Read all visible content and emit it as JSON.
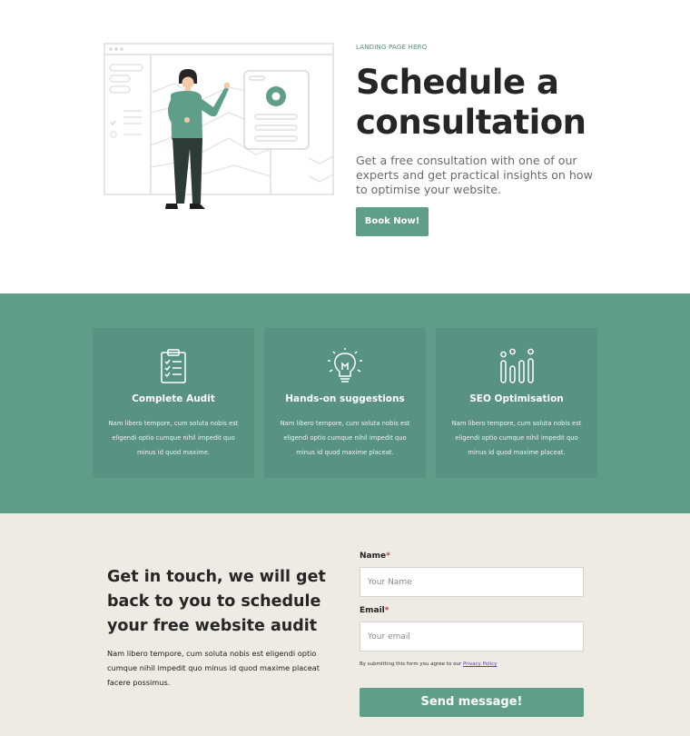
{
  "hero": {
    "eyebrow": "LANDING PAGE HERO",
    "title": "Schedule a consultation",
    "subtitle": "Get a free consultation with one of our experts and get practical insights on how to optimise your website.",
    "cta_label": "Book Now!",
    "illustration_icon": "person-pointing-at-dashboard-illustration"
  },
  "features": {
    "items": [
      {
        "icon": "clipboard-checklist-icon",
        "title": "Complete Audit",
        "description": "Nam libero tempore, cum soluta nobis est eligendi optio cumque nihil impedit quo minus id quod maxime."
      },
      {
        "icon": "lightbulb-icon",
        "title": "Hands-on suggestions",
        "description": "Nam libero tempore, cum soluta nobis est eligendi optio cumque nihil impedit quo minus id quod maxime placeat."
      },
      {
        "icon": "bar-chart-icon",
        "title": "SEO Optimisation",
        "description": "Nam libero tempore, cum soluta nobis est eligendi optio cumque nihil impedit quo minus id quod maxime placeat."
      }
    ]
  },
  "contact": {
    "title": "Get in touch, we will get back to you to schedule your free website audit",
    "description": "Nam libero tempore, cum soluta nobis est eligendi optio cumque nihil impedit quo minus id quod maxime placeat facere possimus.",
    "name_label": "Name",
    "name_placeholder": "Your Name",
    "email_label": "Email",
    "email_placeholder": "Your email",
    "required_marker": "*",
    "terms_text": "By submitting this form you agree to our",
    "privacy_link": "Privacy Policy",
    "submit_label": "Send message!"
  },
  "colors": {
    "accent": "#5f9e88",
    "features_bg": "#609d88",
    "card_bg": "#579282",
    "contact_bg": "#eeeae4",
    "required": "#c43c3c"
  }
}
